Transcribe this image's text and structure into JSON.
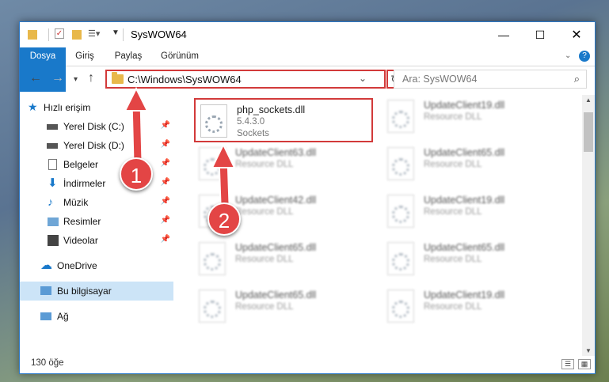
{
  "window": {
    "title": "SysWOW64"
  },
  "ribbon": {
    "tabs": [
      "Dosya",
      "Giriş",
      "Paylaş",
      "Görünüm"
    ]
  },
  "address": {
    "path": "C:\\Windows\\SysWOW64"
  },
  "search": {
    "placeholder": "Ara: SysWOW64"
  },
  "sidebar": {
    "quick_access": "Hızlı erişim",
    "items": [
      {
        "label": "Yerel Disk (C:)",
        "icon": "drive-icon"
      },
      {
        "label": "Yerel Disk (D:)",
        "icon": "drive-icon"
      },
      {
        "label": "Belgeler",
        "icon": "documents-icon"
      },
      {
        "label": "İndirmeler",
        "icon": "download-icon"
      },
      {
        "label": "Müzik",
        "icon": "music-icon"
      },
      {
        "label": "Resimler",
        "icon": "pictures-icon"
      },
      {
        "label": "Videolar",
        "icon": "video-icon"
      }
    ],
    "onedrive": "OneDrive",
    "this_pc": "Bu bilgisayar",
    "network": "Ağ"
  },
  "files": {
    "highlighted": {
      "name": "php_sockets.dll",
      "version": "5.4.3.0",
      "description": "Sockets"
    },
    "left_column": [
      {
        "name": "UpdateClient63.dll",
        "type": "Resource DLL"
      },
      {
        "name": "UpdateClient42.dll",
        "type": "Resource DLL"
      },
      {
        "name": "UpdateClient65.dll",
        "type": "Resource DLL"
      },
      {
        "name": "UpdateClient65.dll",
        "type": "Resource DLL"
      }
    ],
    "right_column": [
      {
        "name": "UpdateClient19.dll",
        "type": "Resource DLL"
      },
      {
        "name": "UpdateClient65.dll",
        "type": "Resource DLL"
      },
      {
        "name": "UpdateClient19.dll",
        "type": "Resource DLL"
      },
      {
        "name": "UpdateClient65.dll",
        "type": "Resource DLL"
      },
      {
        "name": "UpdateClient19.dll",
        "type": "Resource DLL"
      }
    ]
  },
  "status": {
    "count": "130 öğe"
  },
  "annotations": {
    "step1": "1",
    "step2": "2"
  },
  "colors": {
    "accent": "#1979ca",
    "highlight": "#d23a3a"
  }
}
